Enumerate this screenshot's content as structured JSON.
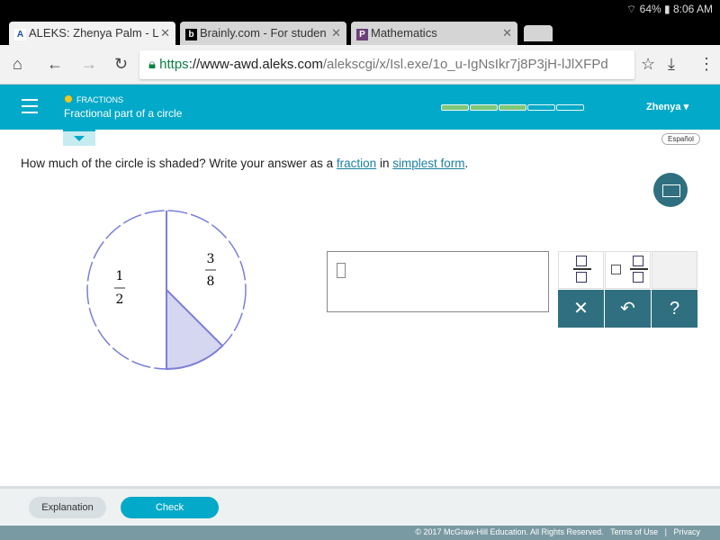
{
  "status": {
    "battery": "64%",
    "time": "8:06 AM"
  },
  "tabs": [
    {
      "label": "ALEKS: Zhenya Palm - L",
      "icon": "A"
    },
    {
      "label": "Brainly.com - For studen",
      "icon": "b"
    },
    {
      "label": "Mathematics",
      "icon": "P"
    }
  ],
  "url": {
    "scheme": "https",
    "domain": "://www-awd.aleks.com",
    "path": "/alekscgi/x/Isl.exe/1o_u-IgNsIkr7j8P3jH-lJlXFPd"
  },
  "header": {
    "topic": "FRACTIONS",
    "title": "Fractional part of a circle",
    "user": "Zhenya ▾",
    "progress": {
      "completed": 3,
      "total": 5
    }
  },
  "espanol": "Español",
  "question": {
    "before": "How much of the circle is shaded? Write your answer as a ",
    "link1": "fraction",
    "mid": " in ",
    "link2": "simplest form",
    "after": "."
  },
  "diagram": {
    "left_num": "1",
    "left_den": "2",
    "right_num": "3",
    "right_den": "8",
    "shaded_fraction": "1/8",
    "stroke": "#7b7fd6",
    "fill": "#d5d6ef"
  },
  "keypad": {
    "clear": "✕",
    "undo": "↶",
    "help": "?"
  },
  "buttons": {
    "explanation": "Explanation",
    "check": "Check"
  },
  "footer": {
    "copyright": "© 2017 McGraw-Hill Education. All Rights Reserved.",
    "terms": "Terms of Use",
    "sep": "|",
    "privacy": "Privacy"
  }
}
